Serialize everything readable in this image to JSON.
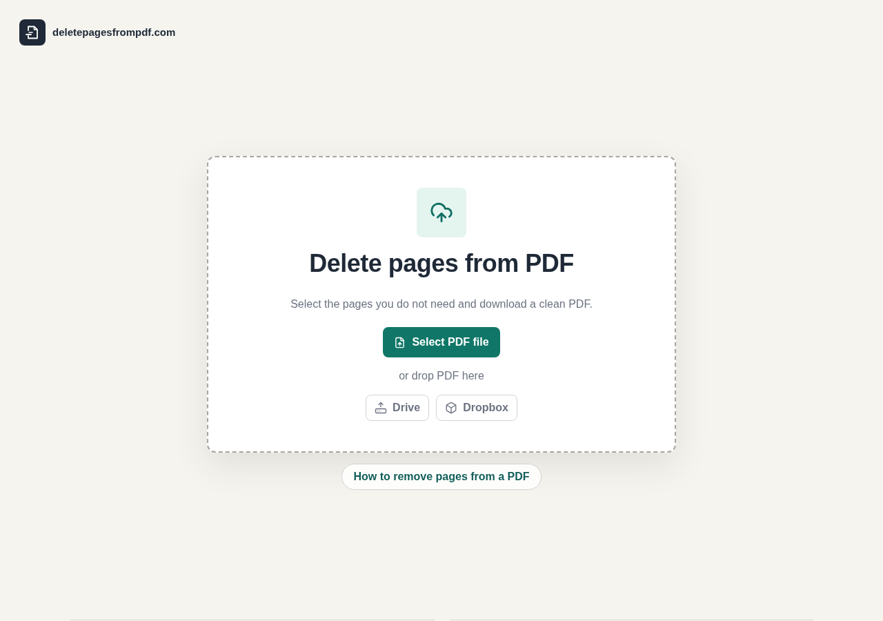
{
  "header": {
    "site_name": "deletepagesfrompdf.com"
  },
  "upload_card": {
    "title": "Delete pages from PDF",
    "subtitle": "Select the pages you do not need and download a clean PDF.",
    "primary_button": "Select PDF file",
    "drop_hint": "or drop PDF here",
    "sources": [
      {
        "label": "Drive",
        "kind": "drive"
      },
      {
        "label": "Dropbox",
        "kind": "dropbox"
      }
    ]
  },
  "guide_link": "How to remove pages from a PDF"
}
